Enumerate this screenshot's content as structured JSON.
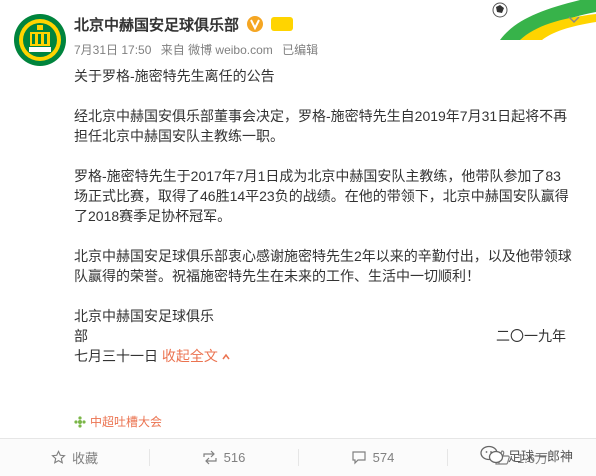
{
  "header": {
    "account_name": "北京中赫国安足球俱乐部",
    "date": "7月31日 17:50",
    "source": "来自 微博 weibo.com",
    "edited": "已编辑"
  },
  "post": {
    "title": "关于罗格-施密特先生离任的公告",
    "paragraph1": "经北京中赫国安俱乐部董事会决定，罗格-施密特先生自2019年7月31日起将不再担任北京中赫国安队主教练一职。",
    "paragraph2": "罗格-施密特先生于2017年7月1日成为北京中赫国安队主教练，他带队参加了83场正式比赛，取得了46胜14平23负的战绩。在他的带领下，北京中赫国安队赢得了2018赛季足协杯冠军。",
    "paragraph3": "北京中赫国安足球俱乐部衷心感谢施密特先生2年以来的辛勤付出，以及他带领球队赢得的荣誉。祝福施密特先生在未来的工作、生活中一切顺利！",
    "signature_line1": "北京中赫国安足球俱乐",
    "signature_line2": "部",
    "signature_year": "二〇一九年",
    "signature_date": "七月三十一日",
    "collapse_label": "收起全文"
  },
  "topic_tag": "中超吐槽大会",
  "actions": {
    "favorite": "收藏",
    "repost_count": "516",
    "comment_count": "574",
    "like_count": "1.6万"
  },
  "watermark": "足球一郎神",
  "colors": {
    "link": "#eb7350",
    "text": "#333333",
    "meta": "#808080"
  }
}
